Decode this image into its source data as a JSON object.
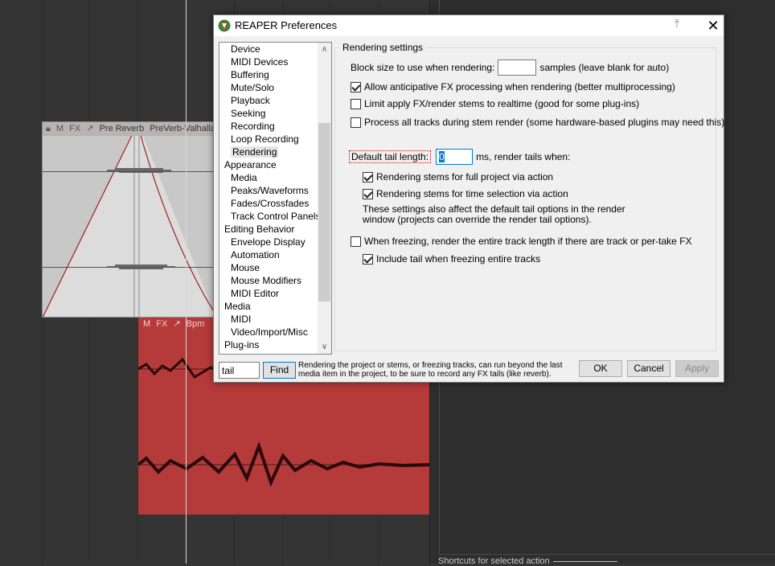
{
  "background": {
    "item_pre": {
      "header_buttons": [
        "M",
        "FX"
      ],
      "name": "Pre Reverb",
      "take": "PreVerb-ValhallaVi"
    },
    "item_bpm": {
      "header_buttons": [
        "M",
        "FX"
      ],
      "name": "Bpm"
    },
    "shortcuts_label": "Shortcuts for selected action"
  },
  "dialog": {
    "title": "REAPER Preferences",
    "categories": [
      {
        "label": "Device",
        "level": 1
      },
      {
        "label": "MIDI Devices",
        "level": 1
      },
      {
        "label": "Buffering",
        "level": 1
      },
      {
        "label": "Mute/Solo",
        "level": 1
      },
      {
        "label": "Playback",
        "level": 1
      },
      {
        "label": "Seeking",
        "level": 1
      },
      {
        "label": "Recording",
        "level": 1
      },
      {
        "label": "Loop Recording",
        "level": 1
      },
      {
        "label": "Rendering",
        "level": 1,
        "selected": true
      },
      {
        "label": "Appearance",
        "level": 0
      },
      {
        "label": "Media",
        "level": 1
      },
      {
        "label": "Peaks/Waveforms",
        "level": 1
      },
      {
        "label": "Fades/Crossfades",
        "level": 1
      },
      {
        "label": "Track Control Panels",
        "level": 1
      },
      {
        "label": "Editing Behavior",
        "level": 0
      },
      {
        "label": "Envelope Display",
        "level": 1
      },
      {
        "label": "Automation",
        "level": 1
      },
      {
        "label": "Mouse",
        "level": 1
      },
      {
        "label": "Mouse Modifiers",
        "level": 1
      },
      {
        "label": "MIDI Editor",
        "level": 1
      },
      {
        "label": "Media",
        "level": 0
      },
      {
        "label": "MIDI",
        "level": 1
      },
      {
        "label": "Video/Import/Misc",
        "level": 1
      },
      {
        "label": "Plug-ins",
        "level": 0
      }
    ],
    "section_title": "Rendering settings",
    "block_size": {
      "label": "Block size to use when rendering:",
      "value": "",
      "suffix": "samples (leave blank for auto)"
    },
    "opt_anticipative": {
      "label": "Allow anticipative FX processing when rendering (better multiprocessing)",
      "checked": true
    },
    "opt_limit_realtime": {
      "label": "Limit apply FX/render stems to realtime (good for some plug-ins)",
      "checked": false
    },
    "opt_process_all": {
      "label": "Process all tracks during stem render (some hardware-based plugins may need this)",
      "checked": false
    },
    "tail_length": {
      "label": "Default tail length:",
      "value": "0",
      "suffix": "ms, render tails when:"
    },
    "opt_stems_full": {
      "label": "Rendering stems for full project via action",
      "checked": true
    },
    "opt_stems_time": {
      "label": "Rendering stems for time selection via action",
      "checked": true
    },
    "tail_note": "These settings also affect the default tail options in the render window (projects can override the render tail options).",
    "opt_freeze_entire": {
      "label": "When freezing, render the entire track length if there are track or per-take FX",
      "checked": false
    },
    "opt_include_tail": {
      "label": "Include tail when freezing entire tracks",
      "checked": true
    },
    "search": {
      "value": "tail",
      "button": "Find"
    },
    "hint": "Rendering the project or stems, or freezing tracks, can run beyond the last media item in the project, to be sure to record any FX tails (like reverb).",
    "buttons": {
      "ok": "OK",
      "cancel": "Cancel",
      "apply": "Apply"
    },
    "colors": {
      "accent": "#0078d7",
      "highlight_border": "#dd0000"
    }
  }
}
